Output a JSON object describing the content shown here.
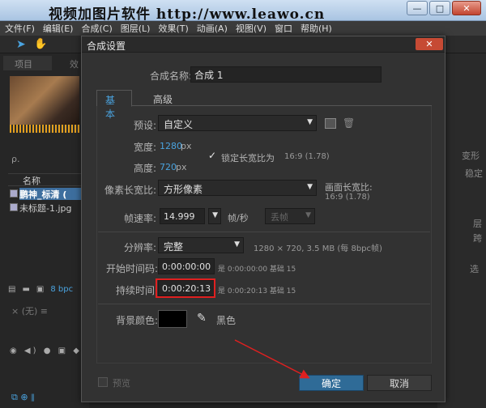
{
  "watermark": "视频加图片软件   http://www.leawo.cn",
  "window_buttons": [
    "—",
    "□",
    "✕"
  ],
  "menu": [
    "文件(F)",
    "编辑(E)",
    "合成(C)",
    "图层(L)",
    "效果(T)",
    "动画(A)",
    "视图(V)",
    "窗口",
    "帮助(H)"
  ],
  "left_panel": {
    "tab": "项目",
    "tab2": "效",
    "search": "ρ.",
    "header": "名称",
    "items": [
      "鹏神_标清 (",
      "未标题-1.jpg"
    ],
    "bpc": "8 bpc",
    "timeline_tab": "×  (无)  ≡"
  },
  "right_panel": {
    "t1": "变形",
    "t2": "稳定",
    "t3": "层",
    "t4": "跨",
    "t5": "选"
  },
  "dialog": {
    "title": "合成设置",
    "close": "✕",
    "name_label": "合成名称:",
    "name_value": "合成 1",
    "tabs": [
      "基本",
      "高级"
    ],
    "preset_label": "预设:",
    "preset_value": "自定义",
    "width_label": "宽度:",
    "width_value": "1280",
    "width_unit": "px",
    "height_label": "高度:",
    "height_value": "720",
    "height_unit": "px",
    "lock_label": "锁定长宽比为",
    "lock_ratio": "16:9 (1.78)",
    "par_label": "像素长宽比:",
    "par_value": "方形像素",
    "frame_ar_label": "画面长宽比:",
    "frame_ar_value": "16:9 (1.78)",
    "fps_label": "帧速率:",
    "fps_value": "14.999",
    "fps_unit": "帧/秒",
    "drop_value": "丢帧",
    "res_label": "分辨率:",
    "res_value": "完整",
    "res_info": "1280 × 720, 3.5 MB (每 8bpc帧)",
    "start_label": "开始时间码:",
    "start_value": "0:00:00:00",
    "start_info": "是 0:00:00:00  基础 15",
    "dur_label": "持续时间:",
    "dur_value": "0:00:20:13",
    "dur_info": "是 0:00:20:13  基础 15",
    "bg_label": "背景颜色:",
    "bg_name": "黑色",
    "bg_color": "#000000",
    "preview_label": "预览",
    "ok": "确定",
    "cancel": "取消"
  },
  "colors": {
    "accent": "#4aa3df",
    "highlight": "#e02020",
    "ok_button": "#2f6b97"
  }
}
